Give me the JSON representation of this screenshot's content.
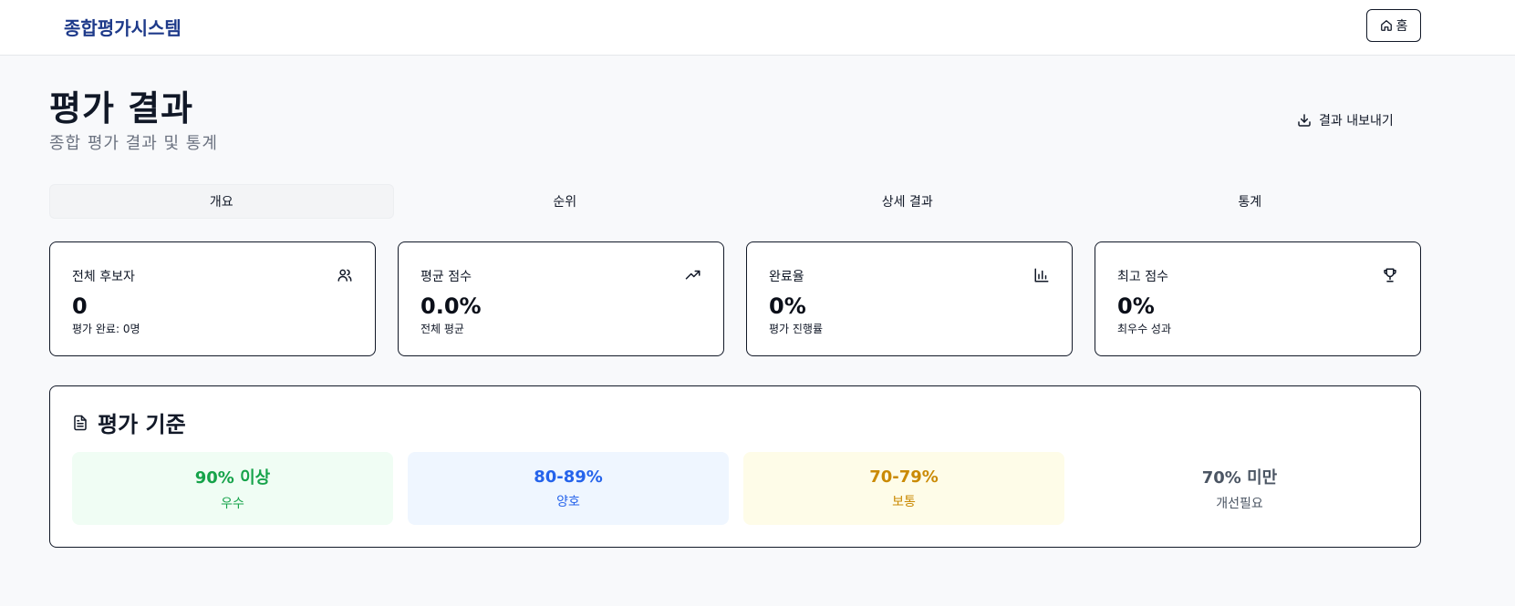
{
  "header": {
    "brand": "종합평가시스템",
    "home_label": "홈",
    "home_icon": "home-icon"
  },
  "page": {
    "title": "평가 결과",
    "subtitle": "종합 평가 결과 및 통계",
    "export_label": "결과 내보내기",
    "export_icon": "download-icon"
  },
  "tabs": [
    {
      "label": "개요",
      "active": true
    },
    {
      "label": "순위",
      "active": false
    },
    {
      "label": "상세 결과",
      "active": false
    },
    {
      "label": "통계",
      "active": false
    }
  ],
  "stats": [
    {
      "label": "전체 후보자",
      "value": "0",
      "desc": "평가 완료: 0명",
      "icon": "users-icon"
    },
    {
      "label": "평균 점수",
      "value": "0.0%",
      "desc": "전체 평균",
      "icon": "trending-up-icon"
    },
    {
      "label": "완료율",
      "value": "0%",
      "desc": "평가 진행률",
      "icon": "bar-chart-icon"
    },
    {
      "label": "최고 점수",
      "value": "0%",
      "desc": "최우수 성과",
      "icon": "trophy-icon"
    }
  ],
  "criteria": {
    "title": "평가 기준",
    "icon": "document-icon",
    "levels": [
      {
        "range": "90% 이상",
        "label": "우수",
        "color": "#16a34a",
        "bg": "#f0fdf4"
      },
      {
        "range": "80-89%",
        "label": "양호",
        "color": "#2563eb",
        "bg": "#eff6ff"
      },
      {
        "range": "70-79%",
        "label": "보통",
        "color": "#ca8a04",
        "bg": "#fefce8"
      },
      {
        "range": "70% 미만",
        "label": "개선필요",
        "color": "#4b5563",
        "bg": "#ffffff"
      }
    ]
  }
}
